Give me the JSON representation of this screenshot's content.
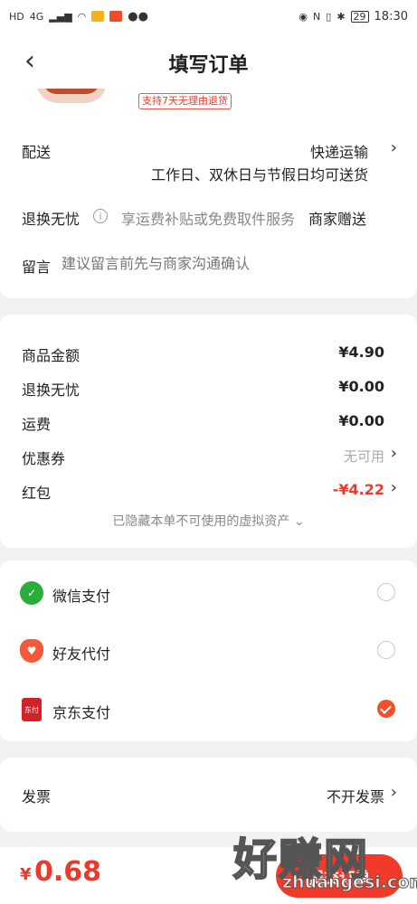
{
  "status_bar": {
    "left_icons": [
      "HD",
      "4G"
    ],
    "time": "18:30",
    "battery": "29"
  },
  "header": {
    "title": "填写订单"
  },
  "product": {
    "return_tag": "支持7天无理由退货"
  },
  "delivery": {
    "label": "配送",
    "method": "快递运输",
    "note": "工作日、双休日与节假日均可送货"
  },
  "worry_free": {
    "label": "退换无忧",
    "desc": "享运费补贴或免费取件服务",
    "value": "商家赠送"
  },
  "message": {
    "label": "留言",
    "placeholder": "建议留言前先与商家沟通确认"
  },
  "fees": {
    "items": [
      {
        "label": "商品金额",
        "value": "¥4.90"
      },
      {
        "label": "退换无忧",
        "value": "¥0.00"
      },
      {
        "label": "运费",
        "value": "¥0.00"
      },
      {
        "label": "优惠券",
        "value": "无可用"
      },
      {
        "label": "红包",
        "value": "-¥4.22"
      }
    ],
    "hidden_note": "已隐藏本单不可使用的虚拟资产"
  },
  "payment": {
    "methods": [
      {
        "label": "微信支付",
        "icon": "wechat-pay-icon",
        "selected": false
      },
      {
        "label": "好友代付",
        "icon": "friend-pay-icon",
        "selected": false
      },
      {
        "label": "京东支付",
        "icon": "jd-pay-icon",
        "selected": true
      }
    ],
    "jd_icon_text": "东付"
  },
  "invoice": {
    "label": "发票",
    "value": "不开发票"
  },
  "footer": {
    "currency": "¥",
    "total": "0.68",
    "submit_label": "提交订单"
  },
  "watermark": {
    "text": "好赚网",
    "url": "zhuangesi.com"
  },
  "colors": {
    "accent": "#e83b2e",
    "pay_button": "#f13a2a",
    "check": "#f0512a",
    "wechat": "#2aae3a"
  }
}
